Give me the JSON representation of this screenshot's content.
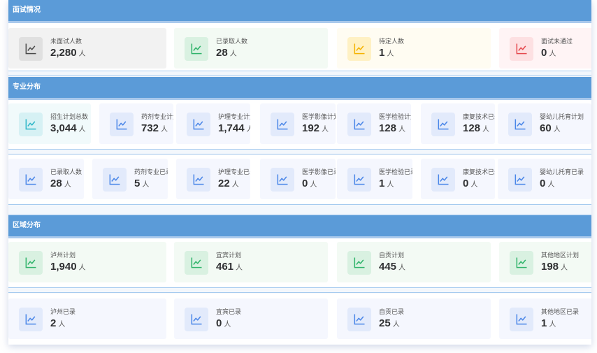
{
  "sections": [
    {
      "title": "面试情况"
    },
    {
      "title": "专业分布"
    },
    {
      "title": "区域分布"
    }
  ],
  "unit": "人",
  "icon": "line-chart-icon",
  "colors": {
    "header": "#5b9bd8",
    "gray": "#4a4a4a",
    "green": "#2fb36a",
    "yellow": "#f5b301",
    "red": "#e5484d",
    "teal": "#2bb6c7",
    "blue": "#4a86e8"
  },
  "rows": [
    [
      {
        "label": "未面试人数",
        "value": "2,280",
        "color": "gray"
      },
      {
        "label": "已录取人数",
        "value": "28",
        "color": "green"
      },
      {
        "label": "待定人数",
        "value": "1",
        "color": "yellow"
      },
      {
        "label": "面试未通过",
        "value": "0",
        "color": "red"
      }
    ],
    [
      {
        "label": "招生计划总数",
        "value": "3,044",
        "color": "teal"
      },
      {
        "label": "药剂专业计划",
        "value": "732",
        "color": "blue"
      },
      {
        "label": "护理专业计划",
        "value": "1,744",
        "color": "blue"
      },
      {
        "label": "医学影像计划",
        "value": "192",
        "color": "blue"
      },
      {
        "label": "医学检验计划",
        "value": "128",
        "color": "blue"
      },
      {
        "label": "康复技术已录",
        "value": "128",
        "color": "blue"
      },
      {
        "label": "婴幼儿托育计划",
        "value": "60",
        "color": "blue"
      }
    ],
    [
      {
        "label": "已录取人数",
        "value": "28",
        "color": "blue"
      },
      {
        "label": "药剂专业已录",
        "value": "5",
        "color": "blue"
      },
      {
        "label": "护理专业已录",
        "value": "22",
        "color": "blue"
      },
      {
        "label": "医学影像已录",
        "value": "0",
        "color": "blue"
      },
      {
        "label": "医学检验已录",
        "value": "1",
        "color": "blue"
      },
      {
        "label": "康复技术已录",
        "value": "0",
        "color": "blue"
      },
      {
        "label": "婴幼儿托育已录",
        "value": "0",
        "color": "blue"
      }
    ],
    [
      {
        "label": "泸州计划",
        "value": "1,940",
        "color": "green"
      },
      {
        "label": "宜宾计划",
        "value": "461",
        "color": "green"
      },
      {
        "label": "自贡计划",
        "value": "445",
        "color": "green"
      },
      {
        "label": "其他地区计划",
        "value": "198",
        "color": "green"
      }
    ],
    [
      {
        "label": "泸州已录",
        "value": "2",
        "color": "blue"
      },
      {
        "label": "宜宾已录",
        "value": "0",
        "color": "blue"
      },
      {
        "label": "自贡已录",
        "value": "25",
        "color": "blue"
      },
      {
        "label": "其他地区已录",
        "value": "1",
        "color": "blue"
      }
    ]
  ]
}
